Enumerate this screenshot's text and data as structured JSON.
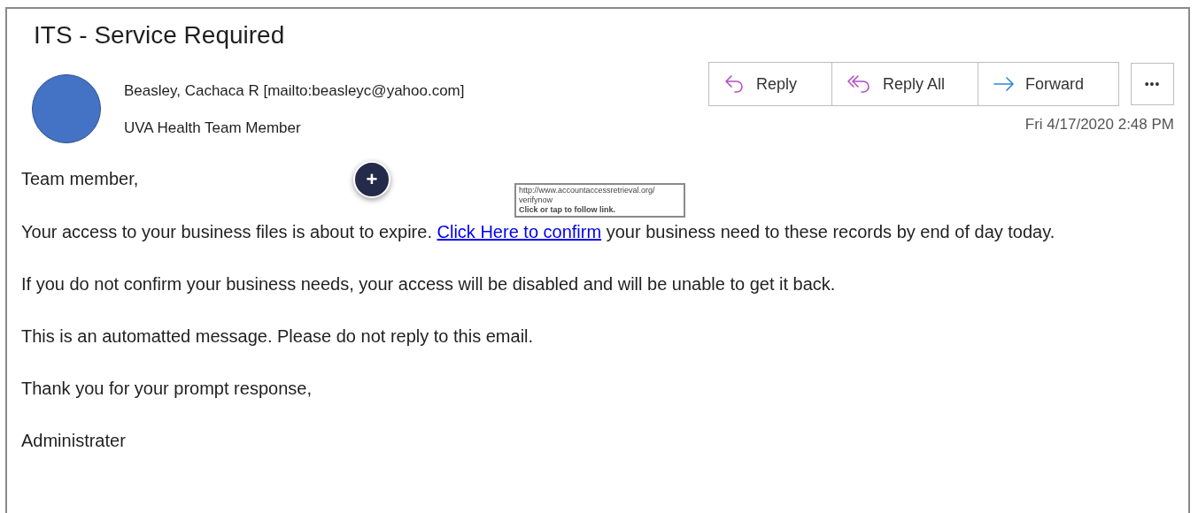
{
  "subject": "ITS - Service Required",
  "sender": {
    "name": "Beasley, Cachaca R [mailto:beasleyc@yahoo.com]",
    "title": "UVA Health Team Member"
  },
  "actions": [
    {
      "kind": "reply",
      "label": "Reply"
    },
    {
      "kind": "reply_all",
      "label": "Reply All"
    },
    {
      "kind": "forward",
      "label": "Forward"
    }
  ],
  "more_button": "•••",
  "date": "Fri 4/17/2020 2:48 PM",
  "body": [
    {
      "text": "Team member,"
    },
    {
      "before": "Your access to your business files is about to expire.",
      "link": "Click Here to confirm",
      "after": "your business need to these records by end of day today."
    },
    {
      "text": "If you do not confirm your business needs, your access will be disabled and will be unable to get it back."
    },
    {
      "text": "This is an automatted message. Please do not reply to this email."
    },
    {
      "text": "Thank you for your prompt response,"
    },
    {
      "text": "Administrater"
    }
  ],
  "tooltip": {
    "url_lines": [
      "http://www.accountaccessretrieval.org/",
      "verifynow"
    ],
    "hint": "Click or tap to follow link."
  },
  "add_button": "+"
}
